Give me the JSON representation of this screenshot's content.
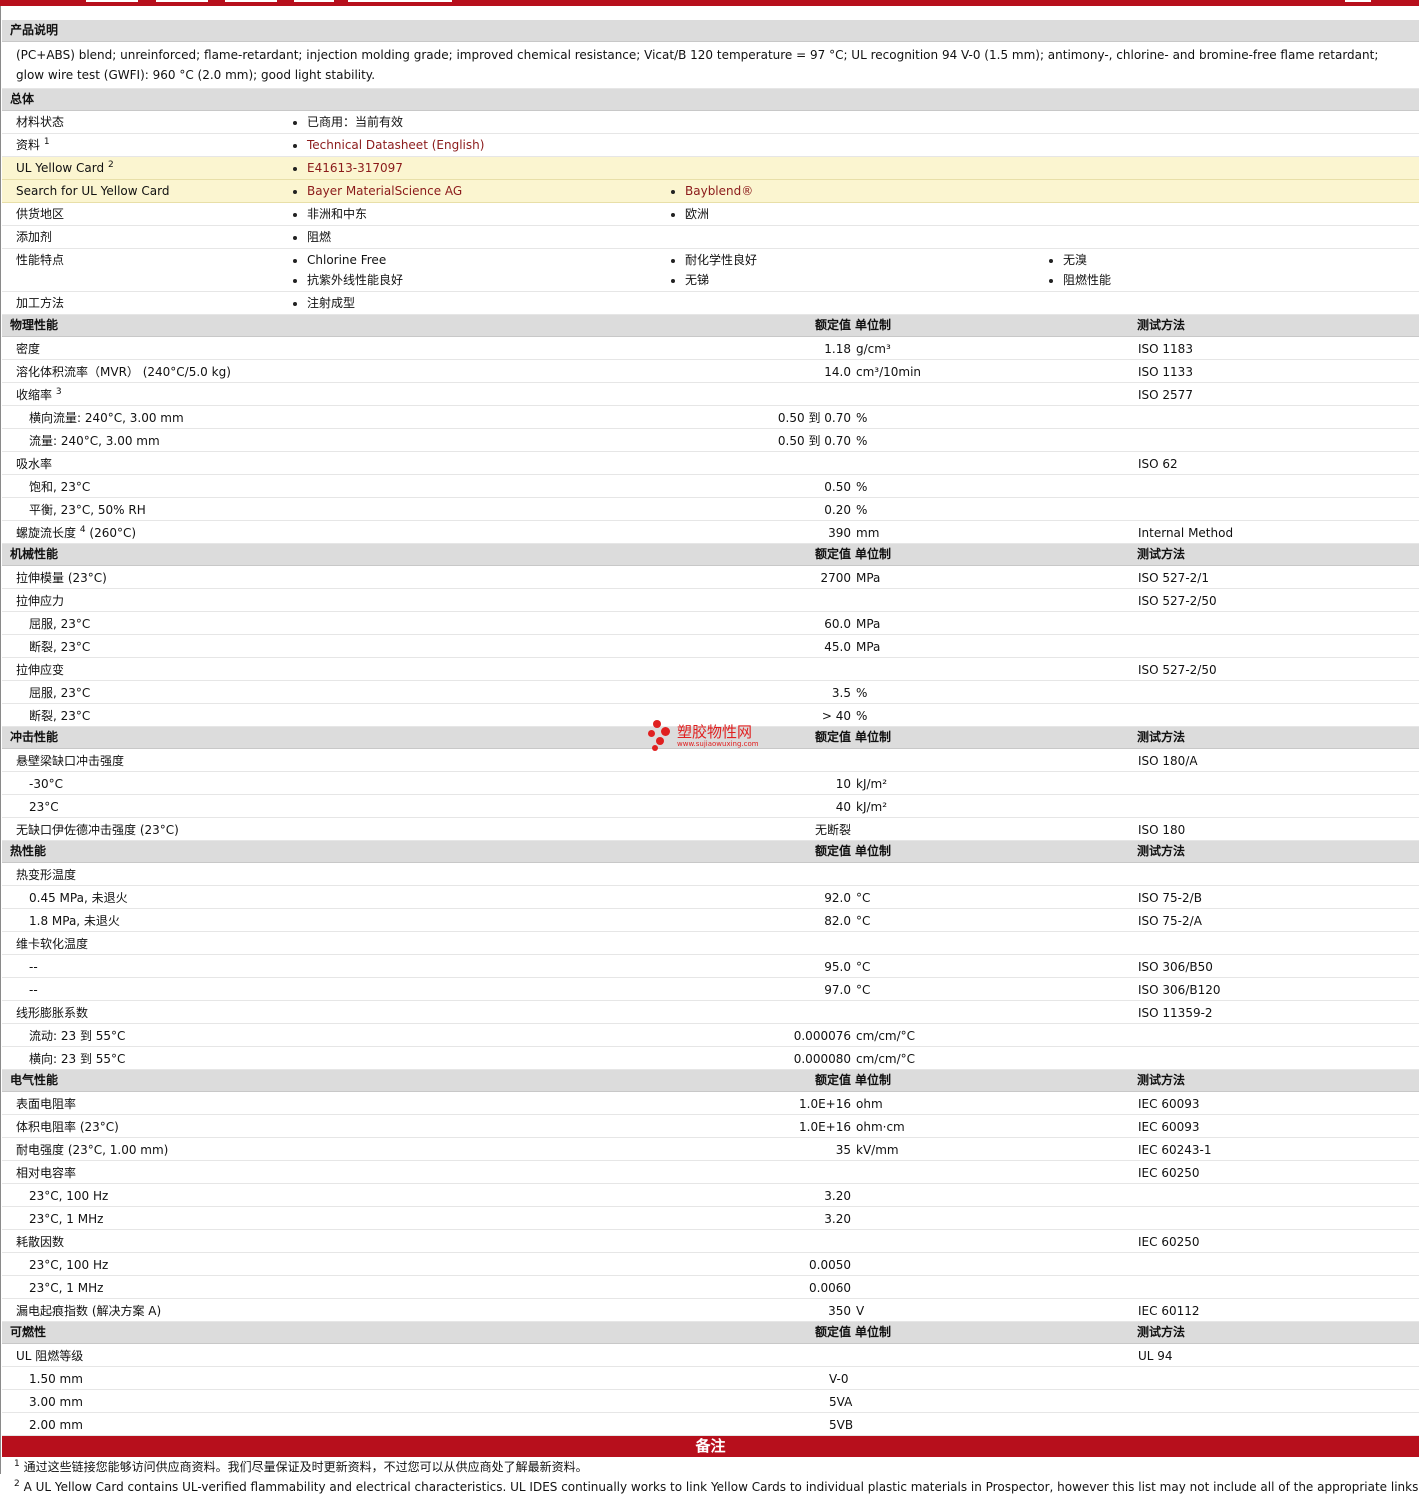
{
  "colors": {
    "brand_red": "#b70f1c",
    "header_gray": "#dcdcdc",
    "highlight_yellow": "#fbf5d0",
    "link": "#8b1a1a"
  },
  "product_description": {
    "title": "产品说明",
    "text": "(PC+ABS) blend; unreinforced; flame-retardant; injection molding grade; improved chemical resistance; Vicat/B 120 temperature = 97 °C; UL recognition 94 V-0 (1.5 mm); antimony-, chlorine- and bromine-free flame retardant; glow wire test (GWFI): 960 °C (2.0 mm); good light stability."
  },
  "general": {
    "title": "总体",
    "rows": [
      {
        "label": "材料状态",
        "sup": "",
        "items": [
          [
            "已商用：当前有效"
          ]
        ]
      },
      {
        "label": "资料",
        "sup": "1",
        "items": [
          [
            "Technical Datasheet (English)"
          ]
        ],
        "link": true
      },
      {
        "label": "UL Yellow Card",
        "sup": "2",
        "items": [
          [
            "E41613-317097"
          ]
        ],
        "link": true,
        "yellow": true
      },
      {
        "label": "Search for UL Yellow Card",
        "sup": "",
        "items": [
          [
            "Bayer MaterialScience AG"
          ],
          [
            "Bayblend®"
          ]
        ],
        "link": true,
        "yellow": true
      },
      {
        "label": "供货地区",
        "sup": "",
        "items": [
          [
            "非洲和中东"
          ],
          [
            "欧洲"
          ]
        ]
      },
      {
        "label": "添加剂",
        "sup": "",
        "items": [
          [
            "阻燃"
          ]
        ]
      },
      {
        "label": "性能特点",
        "sup": "",
        "items": [
          [
            "Chlorine Free",
            "抗紫外线性能良好"
          ],
          [
            "耐化学性良好",
            "无锑"
          ],
          [
            "无溴",
            "阻燃性能"
          ]
        ]
      },
      {
        "label": "加工方法",
        "sup": "",
        "items": [
          [
            "注射成型"
          ]
        ]
      }
    ]
  },
  "col_headers": {
    "value": "额定值",
    "unit": "单位制",
    "method": "测试方法"
  },
  "sections": [
    {
      "title": "物理性能",
      "rows": [
        {
          "label": "密度",
          "value": "1.18",
          "unit": "g/cm³",
          "method": "ISO 1183"
        },
        {
          "label": "溶化体积流率（MVR） (240°C/5.0 kg)",
          "value": "14.0",
          "unit": "cm³/10min",
          "method": "ISO 1133"
        },
        {
          "label": "收缩率",
          "sup": "3",
          "value": "",
          "unit": "",
          "method": "ISO 2577"
        },
        {
          "label": "横向流量: 240°C, 3.00 mm",
          "sub": true,
          "value": "0.50 到  0.70",
          "unit": "%",
          "method": ""
        },
        {
          "label": "流量: 240°C, 3.00 mm",
          "sub": true,
          "value": "0.50 到  0.70",
          "unit": "%",
          "method": ""
        },
        {
          "label": "吸水率",
          "value": "",
          "unit": "",
          "method": "ISO 62"
        },
        {
          "label": "饱和, 23°C",
          "sub": true,
          "value": "0.50",
          "unit": "%",
          "method": ""
        },
        {
          "label": "平衡, 23°C, 50% RH",
          "sub": true,
          "value": "0.20",
          "unit": "%",
          "method": ""
        },
        {
          "label": "螺旋流长度",
          "sup": "4",
          "after": " (260°C)",
          "value": "390",
          "unit": "mm",
          "method": "Internal Method"
        }
      ]
    },
    {
      "title": "机械性能",
      "rows": [
        {
          "label": "拉伸模量 (23°C)",
          "value": "2700",
          "unit": "MPa",
          "method": "ISO 527-2/1"
        },
        {
          "label": "拉伸应力",
          "value": "",
          "unit": "",
          "method": "ISO 527-2/50"
        },
        {
          "label": "屈服, 23°C",
          "sub": true,
          "value": "60.0",
          "unit": "MPa",
          "method": ""
        },
        {
          "label": "断裂, 23°C",
          "sub": true,
          "value": "45.0",
          "unit": "MPa",
          "method": ""
        },
        {
          "label": "拉伸应变",
          "value": "",
          "unit": "",
          "method": "ISO 527-2/50"
        },
        {
          "label": "屈服, 23°C",
          "sub": true,
          "value": "3.5",
          "unit": "%",
          "method": ""
        },
        {
          "label": "断裂, 23°C",
          "sub": true,
          "value": "> 40",
          "unit": "%",
          "method": ""
        }
      ]
    },
    {
      "title": "冲击性能",
      "rows": [
        {
          "label": "悬壁梁缺口冲击强度",
          "value": "",
          "unit": "",
          "method": "ISO 180/A"
        },
        {
          "label": "-30°C",
          "sub": true,
          "value": "10",
          "unit": "kJ/m²",
          "method": ""
        },
        {
          "label": "23°C",
          "sub": true,
          "value": "40",
          "unit": "kJ/m²",
          "method": ""
        },
        {
          "label": "无缺口伊佐德冲击强度 (23°C)",
          "value": "无断裂",
          "unit": "",
          "method": "ISO 180"
        }
      ]
    },
    {
      "title": "热性能",
      "rows": [
        {
          "label": "热变形温度",
          "value": "",
          "unit": "",
          "method": ""
        },
        {
          "label": "0.45 MPa, 未退火",
          "sub": true,
          "value": "92.0",
          "unit": "°C",
          "method": "ISO 75-2/B"
        },
        {
          "label": "1.8 MPa, 未退火",
          "sub": true,
          "value": "82.0",
          "unit": "°C",
          "method": "ISO 75-2/A"
        },
        {
          "label": "维卡软化温度",
          "value": "",
          "unit": "",
          "method": ""
        },
        {
          "label": "--",
          "sub": true,
          "value": "95.0",
          "unit": "°C",
          "method": "ISO 306/B50"
        },
        {
          "label": "--",
          "sub": true,
          "value": "97.0",
          "unit": "°C",
          "method": "ISO 306/B120"
        },
        {
          "label": "线形膨胀系数",
          "value": "",
          "unit": "",
          "method": "ISO 11359-2"
        },
        {
          "label": "流动: 23 到  55°C",
          "sub": true,
          "value": "0.000076",
          "unit": "cm/cm/°C",
          "method": ""
        },
        {
          "label": "横向: 23 到  55°C",
          "sub": true,
          "value": "0.000080",
          "unit": "cm/cm/°C",
          "method": ""
        }
      ]
    },
    {
      "title": "电气性能",
      "rows": [
        {
          "label": "表面电阻率",
          "value": "1.0E+16",
          "unit": "ohm",
          "method": "IEC 60093"
        },
        {
          "label": "体积电阻率 (23°C)",
          "value": "1.0E+16",
          "unit": "ohm·cm",
          "method": "IEC 60093"
        },
        {
          "label": "耐电强度 (23°C, 1.00 mm)",
          "value": "35",
          "unit": "kV/mm",
          "method": "IEC 60243-1"
        },
        {
          "label": "相对电容率",
          "value": "",
          "unit": "",
          "method": "IEC 60250"
        },
        {
          "label": "23°C, 100 Hz",
          "sub": true,
          "value": "3.20",
          "unit": "",
          "method": ""
        },
        {
          "label": "23°C, 1 MHz",
          "sub": true,
          "value": "3.20",
          "unit": "",
          "method": ""
        },
        {
          "label": "耗散因数",
          "value": "",
          "unit": "",
          "method": "IEC 60250"
        },
        {
          "label": "23°C, 100 Hz",
          "sub": true,
          "value": "0.0050",
          "unit": "",
          "method": ""
        },
        {
          "label": "23°C, 1 MHz",
          "sub": true,
          "value": "0.0060",
          "unit": "",
          "method": ""
        },
        {
          "label": "漏电起痕指数 (解决方案 A)",
          "value": "350",
          "unit": "V",
          "method": "IEC 60112"
        }
      ]
    },
    {
      "title": "可燃性",
      "rows": [
        {
          "label": "UL 阻燃等级",
          "value": "",
          "unit": "",
          "method": "UL 94"
        },
        {
          "label": "1.50 mm",
          "sub": true,
          "value": "V-0",
          "unit": "",
          "method": "",
          "left": true
        },
        {
          "label": "3.00 mm",
          "sub": true,
          "value": "5VA",
          "unit": "",
          "method": "",
          "left": true
        },
        {
          "label": "2.00 mm",
          "sub": true,
          "value": "5VB",
          "unit": "",
          "method": "",
          "left": true
        }
      ]
    }
  ],
  "notes": {
    "title": "备注",
    "items": [
      {
        "num": "1",
        "text": "通过这些链接您能够访问供应商资料。我们尽量保证及时更新资料，不过您可以从供应商处了解最新资料。"
      },
      {
        "num": "2",
        "text": "A UL Yellow Card contains UL-verified flammability and electrical characteristics. UL IDES continually works to link Yellow Cards to individual plastic materials in Prospector, however this list may not include all of the appropriate links. It is"
      }
    ]
  },
  "watermark": {
    "name": "塑胶物性网",
    "url": "www.sujiaowuxing.com"
  }
}
